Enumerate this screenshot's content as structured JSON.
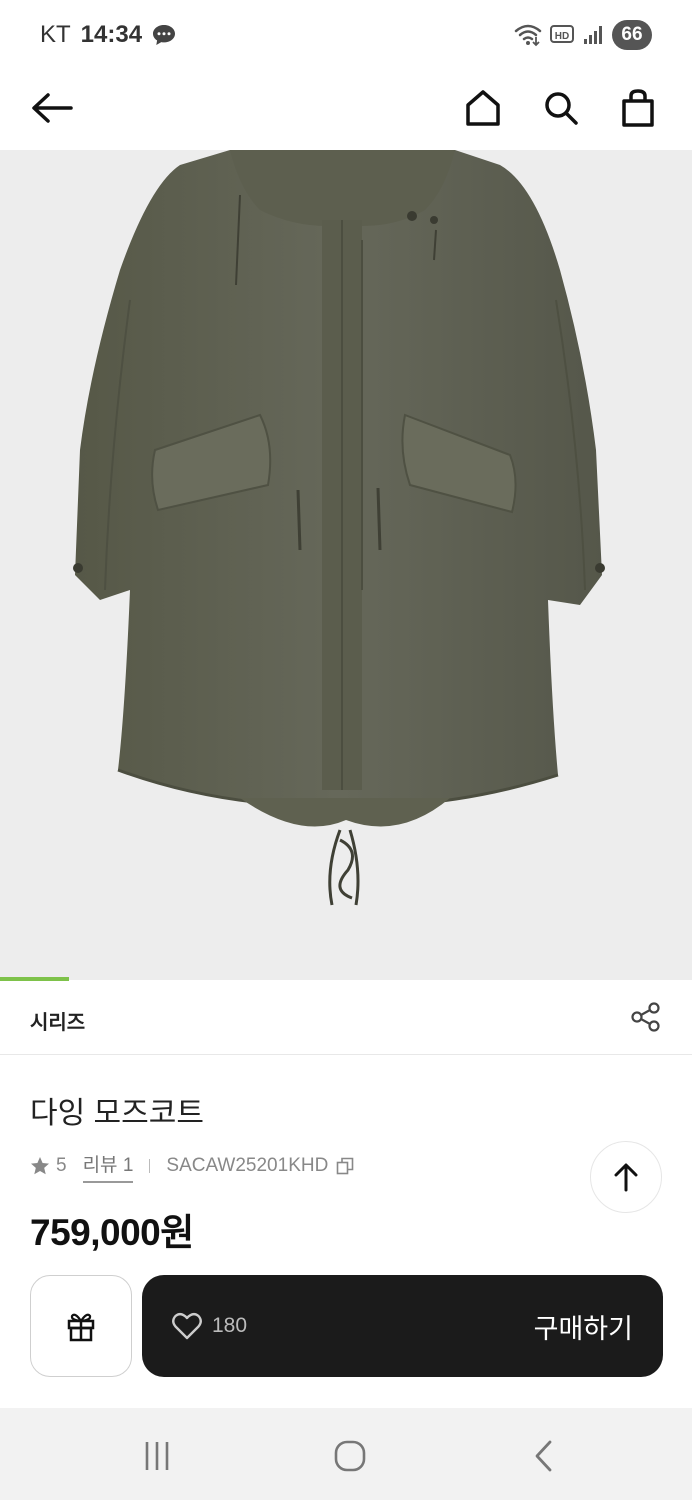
{
  "status_bar": {
    "carrier": "KT",
    "time": "14:34",
    "battery": "66",
    "icons": [
      "chat-icon",
      "wifi-icon",
      "hd-icon",
      "signal-icon"
    ]
  },
  "header": {
    "icons": [
      "back-arrow-icon",
      "home-icon",
      "search-icon",
      "shopping-bag-icon"
    ]
  },
  "image": {
    "subject": "olive-parka-photo",
    "progress": 0.1
  },
  "series": {
    "label": "시리즈",
    "share_icon": "share-icon"
  },
  "product": {
    "name": "다잉 모즈코트",
    "rating": "5",
    "review_label": "리뷰 1",
    "code": "SACAW25201KHD",
    "price": "759,000원"
  },
  "actions": {
    "wish_count": "180",
    "buy_label": "구매하기",
    "gift_icon": "gift-icon",
    "heart_icon": "heart-icon"
  },
  "colors": {
    "accent": "#7ec24a",
    "buy_bar": "#1b1b1b",
    "coat": "#5f6150"
  },
  "nav": {
    "icons": [
      "recent-apps-icon",
      "home-circle-icon",
      "back-chevron-icon"
    ]
  }
}
